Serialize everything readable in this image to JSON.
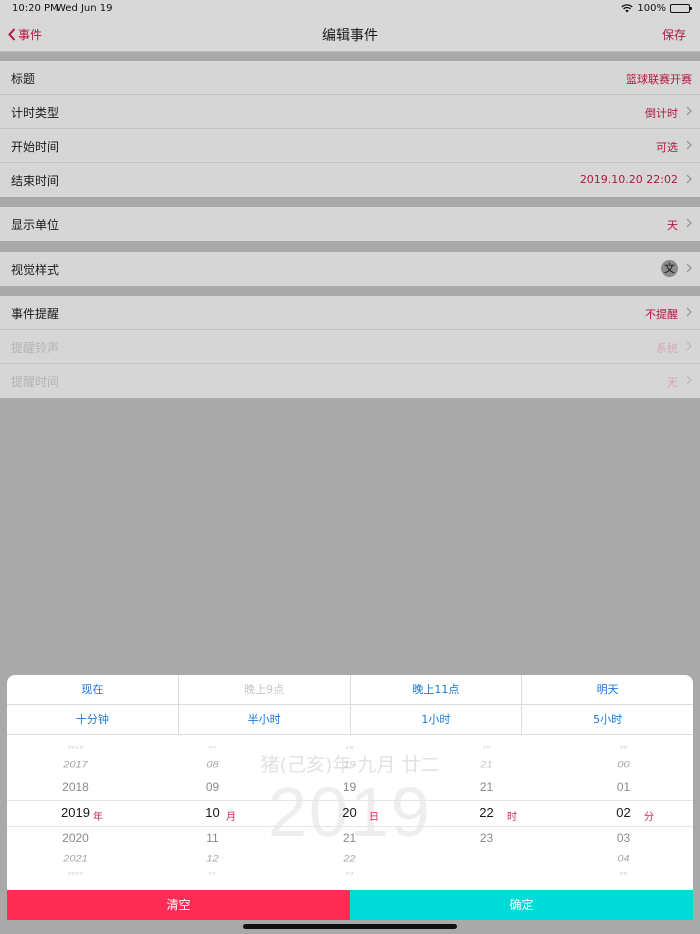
{
  "status_bar": {
    "time": "10:20 PM",
    "date": "Wed Jun 19",
    "battery": "100%"
  },
  "nav": {
    "back_label": "事件",
    "title": "编辑事件",
    "save_label": "保存"
  },
  "groups": [
    {
      "rows": [
        {
          "label": "标题",
          "value": "篮球联赛开赛"
        },
        {
          "label": "计时类型",
          "value": "倒计时"
        },
        {
          "label": "开始时间",
          "value": "可选"
        },
        {
          "label": "结束时间",
          "value": "2019.10.20 22:02"
        }
      ]
    },
    {
      "rows": [
        {
          "label": "显示单位",
          "value": "天"
        }
      ]
    },
    {
      "rows": [
        {
          "label": "视觉样式",
          "value": "文"
        }
      ]
    },
    {
      "rows": [
        {
          "label": "事件提醒",
          "value": "不提醒"
        },
        {
          "label": "提醒铃声",
          "value": "系统"
        },
        {
          "label": "提醒时间",
          "value": "无"
        }
      ]
    }
  ],
  "quick_picks": {
    "row1": [
      "现在",
      "晚上9点",
      "晚上11点",
      "明天"
    ],
    "row2": [
      "十分钟",
      "半小时",
      "1小时",
      "5小时"
    ]
  },
  "picker": {
    "background_year": "2019",
    "lunar_date": "猪(己亥)年 九月 廿二",
    "columns": [
      {
        "name": "year",
        "items": [
          "2016",
          "2017",
          "2018",
          "2019",
          "2020",
          "2021",
          "2022"
        ],
        "unit": "年"
      },
      {
        "name": "month",
        "items": [
          "07",
          "08",
          "09",
          "10",
          "11",
          "12",
          "01"
        ],
        "unit": "月"
      },
      {
        "name": "day",
        "items": [
          "18",
          "19",
          "19",
          "20",
          "21",
          "22",
          "23"
        ],
        "unit": "日"
      },
      {
        "name": "hour",
        "items": [
          "20",
          "21",
          "21",
          "22",
          "23",
          "",
          ""
        ],
        "unit": "时"
      },
      {
        "name": "minute",
        "items": [
          "59",
          "00",
          "01",
          "02",
          "03",
          "04",
          "05"
        ],
        "unit": "分"
      }
    ]
  },
  "actions": {
    "clear_label": "清空",
    "confirm_label": "确定"
  },
  "colors": {
    "accent": "#b3163f",
    "link": "#1678d4",
    "clear": "#ff2d55",
    "confirm": "#00dbd8"
  }
}
